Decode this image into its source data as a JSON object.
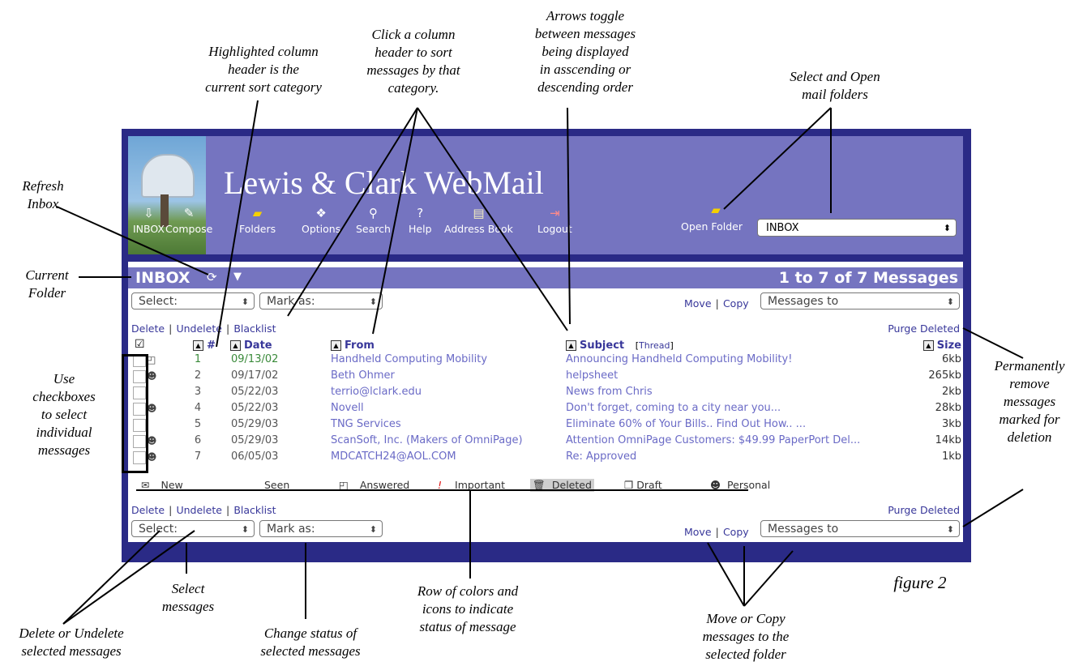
{
  "app": {
    "title": "Lewis & Clark WebMail"
  },
  "toolbar": [
    {
      "label": "INBOX",
      "icon": "inbox-icon",
      "glyph": "⇩"
    },
    {
      "label": "Compose",
      "icon": "compose-icon",
      "glyph": "✎"
    },
    {
      "label": "Folders",
      "icon": "folders-icon",
      "glyph": "▰"
    },
    {
      "label": "Options",
      "icon": "options-icon",
      "glyph": "❖"
    },
    {
      "label": "Search",
      "icon": "search-icon",
      "glyph": "⚲"
    },
    {
      "label": "Help",
      "icon": "help-icon",
      "glyph": "?"
    },
    {
      "label": "Address Book",
      "icon": "address-book-icon",
      "glyph": "▤"
    },
    {
      "label": "Logout",
      "icon": "logout-icon",
      "glyph": "⇥"
    }
  ],
  "open_folder": {
    "label": "Open Folder",
    "selected": "INBOX"
  },
  "folder_bar": {
    "name": "INBOX",
    "count": "1 to 7 of 7 Messages"
  },
  "controls": {
    "select_placeholder": "Select:",
    "mark_as_placeholder": "Mark as:",
    "move": "Move",
    "copy": "Copy",
    "messages_to": "Messages to",
    "delete": "Delete",
    "undelete": "Undelete",
    "blacklist": "Blacklist",
    "purge_deleted": "Purge Deleted"
  },
  "columns": {
    "num": "#",
    "date": "Date",
    "from": "From",
    "subject": "Subject",
    "thread": "Thread",
    "size": "Size"
  },
  "messages": [
    {
      "num": "1",
      "date": "09/13/02",
      "from": "Handheld Computing Mobility",
      "subject": "Announcing Handheld Computing Mobility!",
      "size": "6kb"
    },
    {
      "num": "2",
      "date": "09/17/02",
      "from": "Beth Ohmer",
      "subject": "helpsheet",
      "size": "265kb"
    },
    {
      "num": "3",
      "date": "05/22/03",
      "from": "terrio@lclark.edu",
      "subject": "News from Chris",
      "size": "2kb"
    },
    {
      "num": "4",
      "date": "05/22/03",
      "from": "Novell",
      "subject": "Don't forget, coming to a city near you...",
      "size": "28kb"
    },
    {
      "num": "5",
      "date": "05/29/03",
      "from": "TNG Services",
      "subject": "Eliminate 60% of Your Bills.. Find Out How.. ...",
      "size": "3kb"
    },
    {
      "num": "6",
      "date": "05/29/03",
      "from": "ScanSoft, Inc. (Makers of OmniPage)",
      "subject": "Attention OmniPage Customers: $49.99 PaperPort Del...",
      "size": "14kb"
    },
    {
      "num": "7",
      "date": "06/05/03",
      "from": "MDCATCH24@AOL.COM",
      "subject": "Re: Approved",
      "size": "1kb"
    }
  ],
  "legend": [
    "New",
    "Seen",
    "Answered",
    "Important",
    "Deleted",
    "Draft",
    "Personal"
  ],
  "callouts": {
    "highlighted": "Highlighted column\nheader is the\ncurrent sort category",
    "click_column": "Click a column\nheader to sort\nmessages by that\ncategory.",
    "arrows": "Arrows toggle\nbetween messages\nbeing displayed\nin asscending or\ndescending order",
    "select_open": "Select and Open\nmail folders",
    "refresh": "Refresh\nInbox",
    "current_folder": "Current\nFolder",
    "use_checkboxes": "Use\ncheckboxes\nto select\nindividual\nmessages",
    "permanently": "Permanently\nremove\nmessages\nmarked for\ndeletion",
    "figure": "figure 2",
    "select_messages": "Select\nmessages",
    "delete_undelete": "Delete or Undelete\nselected messages",
    "change_status": "Change status of\nselected messages",
    "row_colors": "Row of colors and\nicons to indicate\nstatus of message",
    "move_copy": "Move or Copy\nmessages to the\nselected folder"
  }
}
